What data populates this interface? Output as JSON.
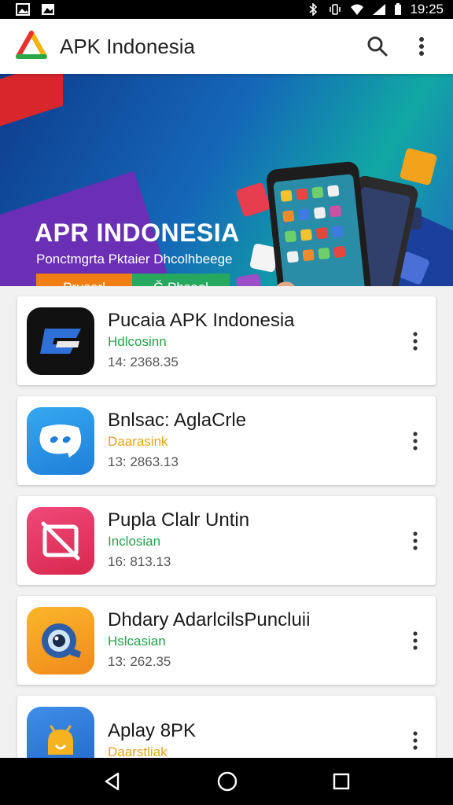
{
  "status_bar": {
    "time": "19:25"
  },
  "app_bar": {
    "title": "APK Indonesia",
    "search_icon": "search-icon",
    "menu_icon": "overflow-menu-icon"
  },
  "banner": {
    "title": "APR INDONESIA",
    "subtitle": "Ponctmgrta Pktaier Dhcolhbeege",
    "cta_left": "Pruserl",
    "cta_right": "Ğ Phsool",
    "colors": {
      "cta_left": "#f07e12",
      "cta_right": "#26a85e"
    }
  },
  "apps": [
    {
      "name": "Pucaia APK Indonesia",
      "category": "Hdlcosinn",
      "meta": "14: 2368.35",
      "category_color": "green"
    },
    {
      "name": "Bnlsac: AglaCrle",
      "category": "Daarasink",
      "meta": "13: 2863.13",
      "category_color": "orange"
    },
    {
      "name": "Pupla Clalr Untin",
      "category": "Inclosian",
      "meta": "16: 813.13",
      "category_color": "green"
    },
    {
      "name": "Dhdary AdarlcilsPuncluii",
      "category": "Hslcasian",
      "meta": "13: 262.35",
      "category_color": "green"
    },
    {
      "name": "Aplay 8PK",
      "category": "Daarstliak",
      "meta": "",
      "category_color": "orange"
    }
  ],
  "nav": {
    "back": "back-icon",
    "home": "home-icon",
    "recents": "recents-icon"
  }
}
